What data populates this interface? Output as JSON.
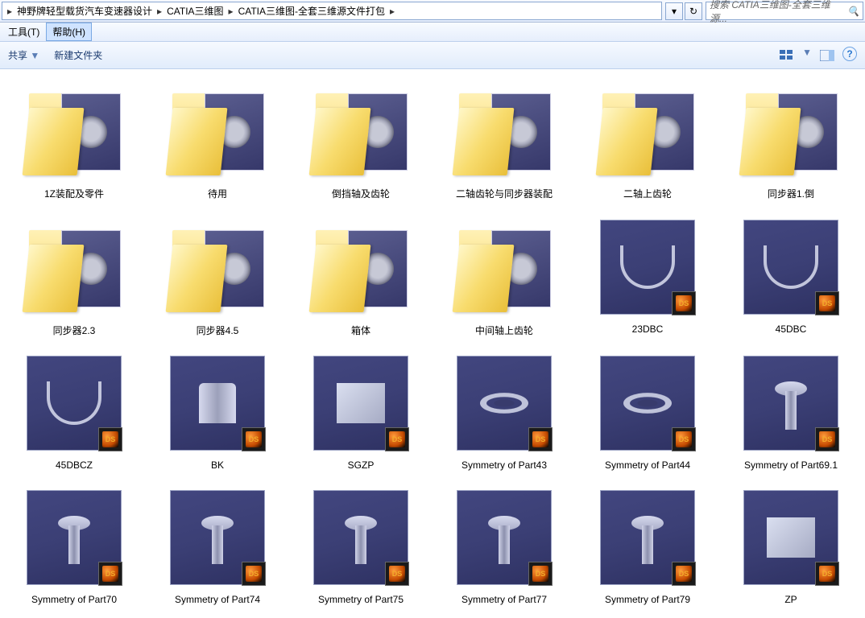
{
  "breadcrumb": {
    "items": [
      {
        "label": "神野牌轻型载货汽车变速器设计"
      },
      {
        "label": "CATIA三维图"
      },
      {
        "label": "CATIA三维图-全套三维源文件打包"
      }
    ]
  },
  "search": {
    "placeholder": "搜索 CATIA三维图-全套三维源..."
  },
  "menu": {
    "tools": "工具(T)",
    "help": "帮助(H)"
  },
  "toolbar": {
    "share": "共享",
    "newfolder": "新建文件夹"
  },
  "items": [
    {
      "name": "1Z装配及零件",
      "type": "folder"
    },
    {
      "name": "待用",
      "type": "folder"
    },
    {
      "name": "倒挡轴及齿轮",
      "type": "folder"
    },
    {
      "name": "二轴齿轮与同步器装配",
      "type": "folder"
    },
    {
      "name": "二轴上齿轮",
      "type": "folder"
    },
    {
      "name": "同步器1.倒",
      "type": "folder"
    },
    {
      "name": "同步器2.3",
      "type": "folder"
    },
    {
      "name": "同步器4.5",
      "type": "folder"
    },
    {
      "name": "箱体",
      "type": "folder"
    },
    {
      "name": "中间轴上齿轮",
      "type": "folder"
    },
    {
      "name": "23DBC",
      "type": "part",
      "shape": "fork"
    },
    {
      "name": "45DBC",
      "type": "part",
      "shape": "fork"
    },
    {
      "name": "45DBCZ",
      "type": "part",
      "shape": "fork"
    },
    {
      "name": "BK",
      "type": "part",
      "shape": "cup"
    },
    {
      "name": "SGZP",
      "type": "part",
      "shape": "box"
    },
    {
      "name": "Symmetry of Part43",
      "type": "part",
      "shape": "ring"
    },
    {
      "name": "Symmetry of Part44",
      "type": "part",
      "shape": "ring"
    },
    {
      "name": "Symmetry of Part69.1",
      "type": "part",
      "shape": "pin"
    },
    {
      "name": "Symmetry of Part70",
      "type": "part",
      "shape": "pin"
    },
    {
      "name": "Symmetry of Part74",
      "type": "part",
      "shape": "pin"
    },
    {
      "name": "Symmetry of Part75",
      "type": "part",
      "shape": "pin"
    },
    {
      "name": "Symmetry of Part77",
      "type": "part",
      "shape": "pin"
    },
    {
      "name": "Symmetry of Part79",
      "type": "part",
      "shape": "pin"
    },
    {
      "name": "ZP",
      "type": "part",
      "shape": "box"
    }
  ]
}
